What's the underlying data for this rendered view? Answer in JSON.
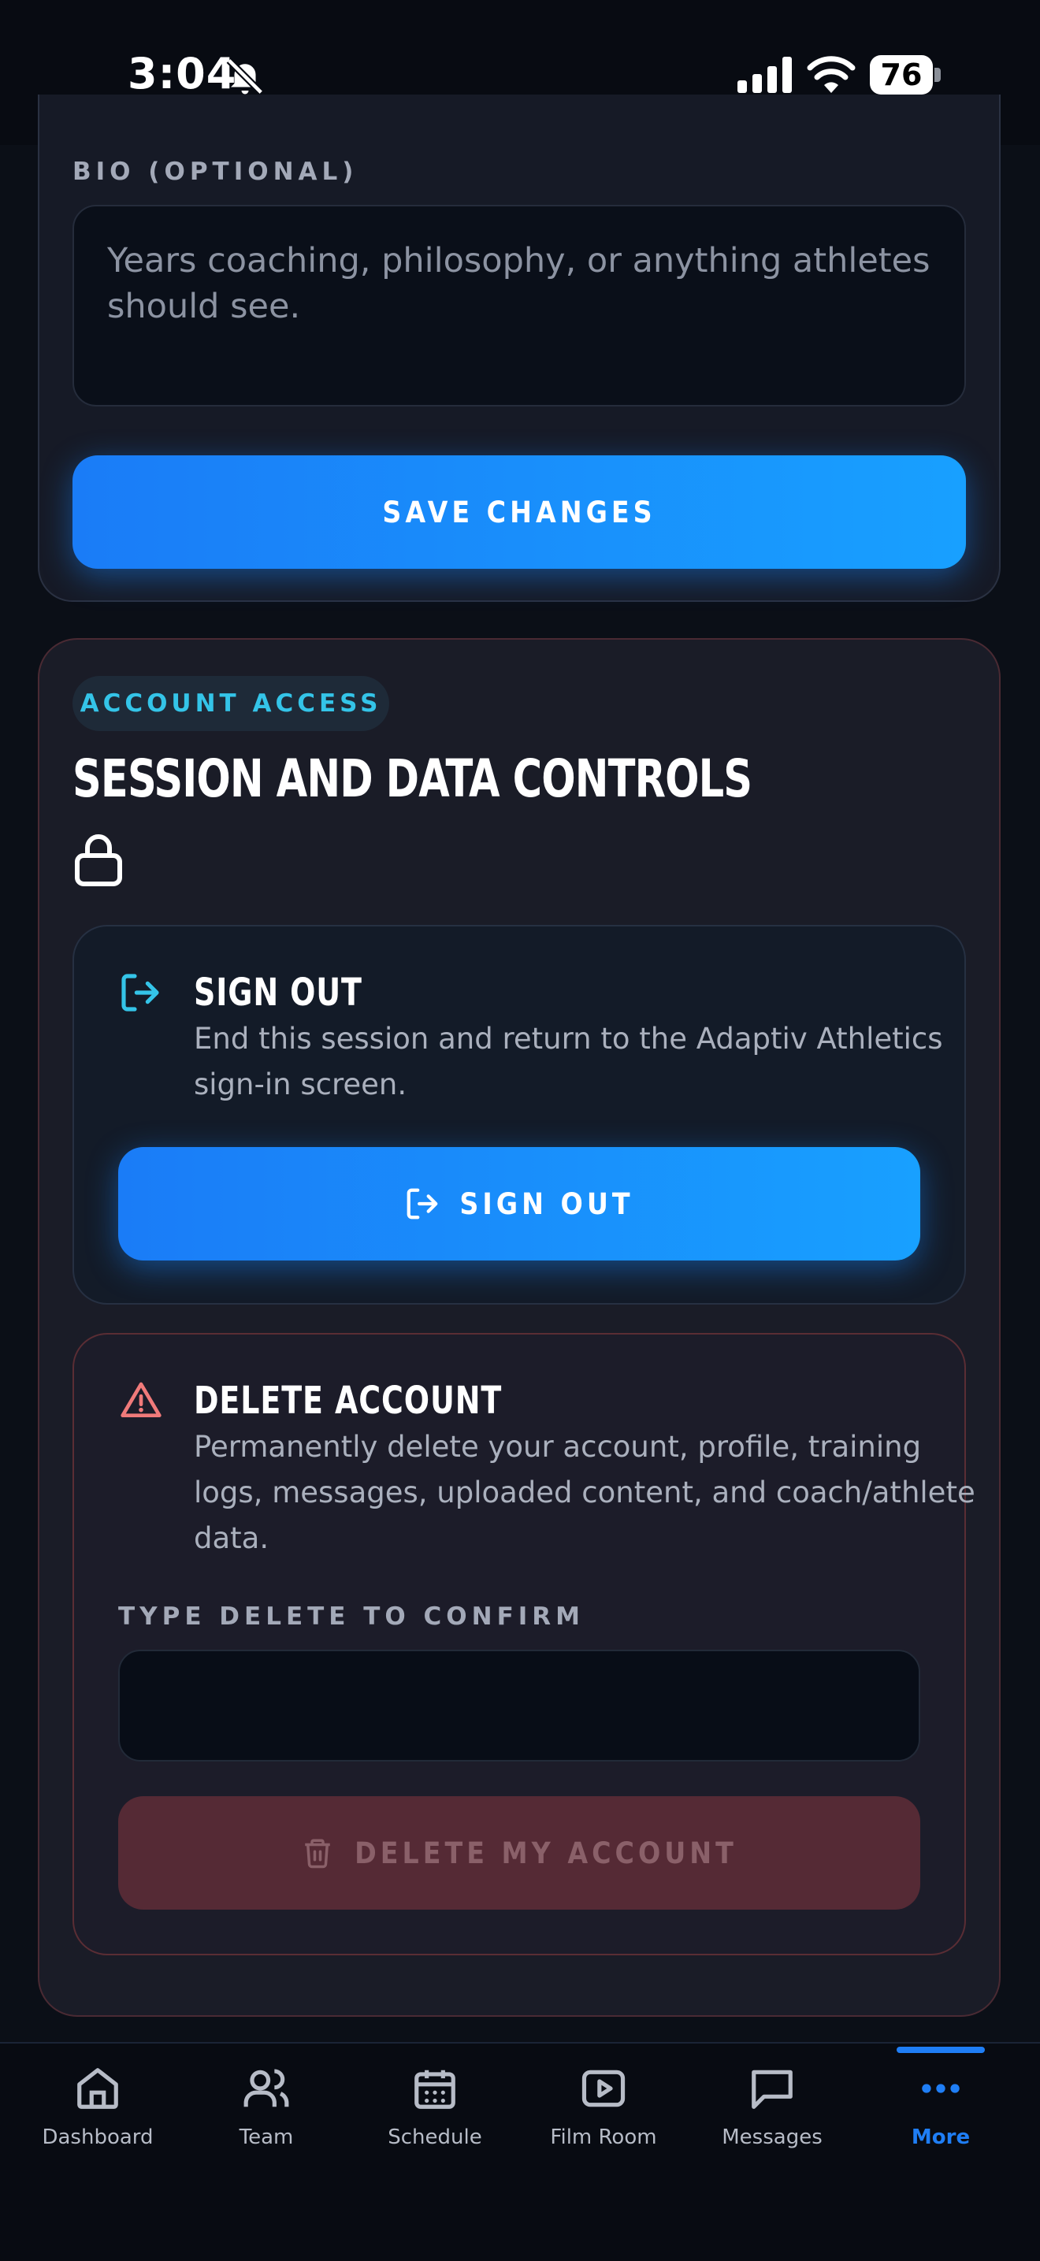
{
  "status_bar": {
    "time": "3:04",
    "battery": "76"
  },
  "profile": {
    "bio_label": "BIO (OPTIONAL)",
    "bio_placeholder": "Years coaching, philosophy, or anything athletes should see.",
    "save_label": "SAVE CHANGES"
  },
  "account": {
    "badge": "ACCOUNT ACCESS",
    "title": "SESSION AND DATA CONTROLS",
    "sign_out": {
      "title": "SIGN OUT",
      "description": "End this session and return to the Adaptiv Athletics sign-in screen.",
      "button_label": "SIGN OUT"
    },
    "delete": {
      "title": "DELETE ACCOUNT",
      "description": "Permanently delete your account, profile, training logs, messages, uploaded content, and coach/athlete data.",
      "confirm_label": "TYPE DELETE TO CONFIRM",
      "confirm_value": "",
      "button_label": "DELETE MY ACCOUNT"
    }
  },
  "tabs": [
    {
      "label": "Dashboard",
      "icon": "home-icon"
    },
    {
      "label": "Team",
      "icon": "users-icon"
    },
    {
      "label": "Schedule",
      "icon": "calendar-icon"
    },
    {
      "label": "Film Room",
      "icon": "play-icon"
    },
    {
      "label": "Messages",
      "icon": "message-icon"
    },
    {
      "label": "More",
      "icon": "more-icon",
      "active": true
    }
  ],
  "colors": {
    "accent": "#1f7ef5",
    "danger": "#f07a7a",
    "cyan": "#34c4e8"
  }
}
